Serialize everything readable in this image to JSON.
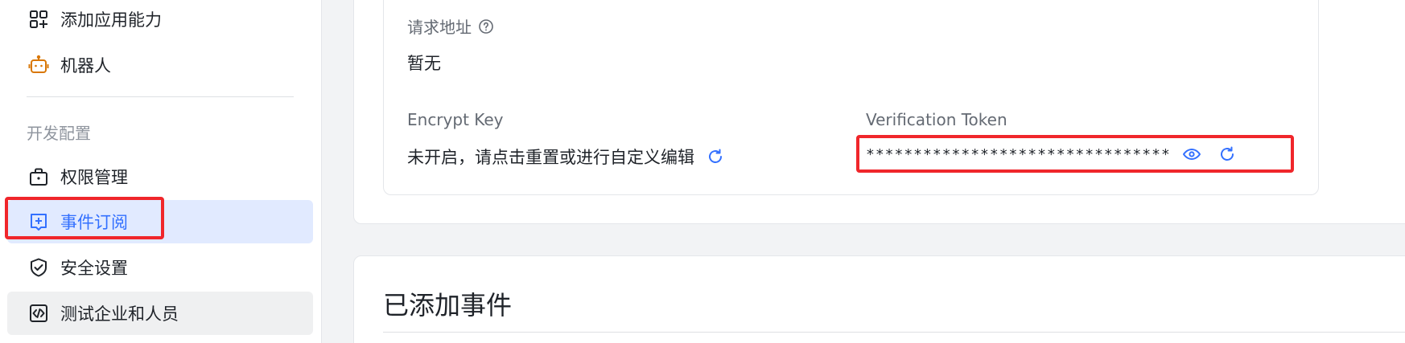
{
  "sidebar": {
    "items_top": [
      {
        "label": "添加应用能力",
        "icon": "apps-add-icon"
      },
      {
        "label": "机器人",
        "icon": "robot-icon"
      }
    ],
    "section_title": "开发配置",
    "items_dev": [
      {
        "label": "权限管理",
        "icon": "briefcase-icon"
      },
      {
        "label": "事件订阅",
        "icon": "event-subscribe-icon",
        "active": true
      },
      {
        "label": "安全设置",
        "icon": "shield-check-icon"
      },
      {
        "label": "测试企业和人员",
        "icon": "code-box-icon",
        "hover": true
      }
    ]
  },
  "event_config": {
    "request_url_label": "请求地址",
    "request_url_value": "暂无",
    "encrypt_key_label": "Encrypt Key",
    "encrypt_key_value": "未开启，请点击重置或进行自定义编辑",
    "verification_token_label": "Verification Token",
    "verification_token_value": "********************************"
  },
  "added_events": {
    "heading": "已添加事件"
  },
  "colors": {
    "accent": "#3370ff",
    "active_bg": "#e1eaff",
    "highlight_red": "#f0262b",
    "robot_orange": "#d97706"
  }
}
